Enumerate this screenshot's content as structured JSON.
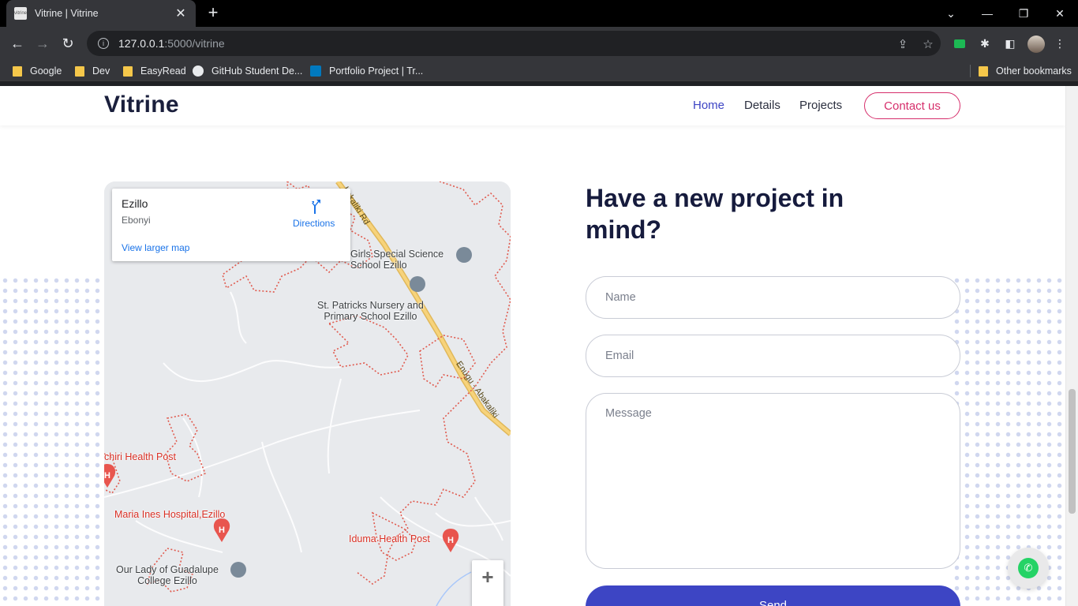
{
  "browser": {
    "tab_title": "Vitrine | Vitrine",
    "favicon_text": "vitrine",
    "url_host": "127.0.0.1",
    "url_path": ":5000/vitrine",
    "bookmarks": [
      {
        "label": "Google"
      },
      {
        "label": "Dev"
      },
      {
        "label": "EasyRead"
      },
      {
        "label": "GitHub Student De..."
      },
      {
        "label": "Portfolio Project | Tr..."
      }
    ],
    "other_bookmarks": "Other bookmarks"
  },
  "site": {
    "brand": "Vitrine",
    "nav": [
      {
        "label": "Home",
        "active": true
      },
      {
        "label": "Details",
        "active": false
      },
      {
        "label": "Projects",
        "active": false
      }
    ],
    "contact_label": "Contact us"
  },
  "map": {
    "place": "Ezillo",
    "region": "Ebonyi",
    "directions": "Directions",
    "view_larger": "View larger map",
    "zoom_in": "+",
    "labels": {
      "girls_school": "Girls Special Science\nSchool Ezillo",
      "st_patricks": "St. Patricks Nursery and\nPrimary School Ezillo",
      "health_post_left": "chiri Health Post",
      "maria_ines": "Maria Ines Hospital,Ezillo",
      "iduma": "Iduma Health Post",
      "our_lady": "Our Lady of Guadalupe\nCollege Ezillo",
      "road_top": "bakaliki Rd",
      "road_bottom": "Enugu - Abakaliki"
    }
  },
  "form": {
    "title": "Have a new project in mind?",
    "name_placeholder": "Name",
    "email_placeholder": "Email",
    "message_placeholder": "Message",
    "send_label": "Send"
  },
  "colors": {
    "accent": "#3d45c4",
    "contact": "#d62e6b",
    "brand_text": "#1a1f3c"
  }
}
